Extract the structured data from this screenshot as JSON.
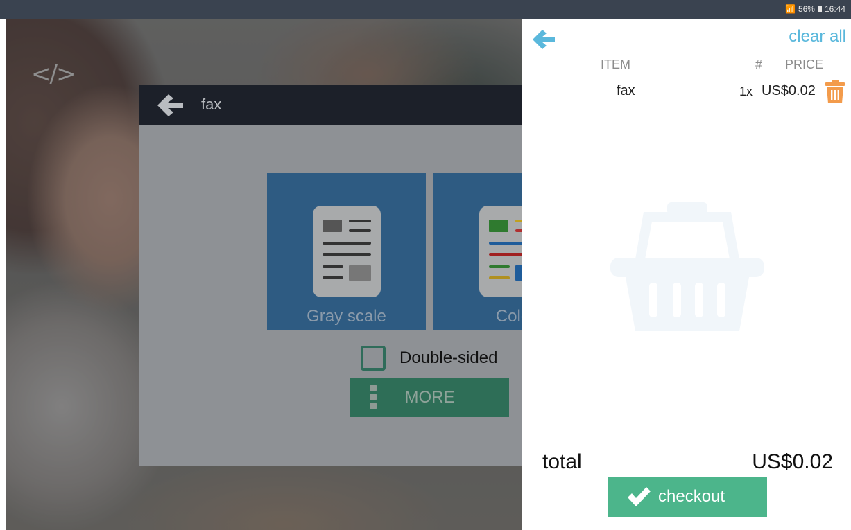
{
  "status_bar": {
    "battery": "56%",
    "time": "16:44",
    "icons": [
      "wifi-icon",
      "battery-icon"
    ]
  },
  "background": {
    "icon": "code-icon",
    "icon_text": "</>"
  },
  "dialog": {
    "title": "fax",
    "back_icon": "arrow-left-icon",
    "options": [
      {
        "label": "Gray scale",
        "icon": "grayscale-document-icon"
      },
      {
        "label": "Color",
        "visible_label": "Colo",
        "icon": "color-document-icon"
      }
    ],
    "double_sided_label": "Double-sided",
    "double_sided_checked": false,
    "more_label": "MORE",
    "more_icon": "more-vertical-icon"
  },
  "cart": {
    "back_icon": "arrow-left-icon",
    "clear_all_label": "clear all",
    "columns": {
      "item": "ITEM",
      "qty": "#",
      "price": "PRICE"
    },
    "items": [
      {
        "name": "fax",
        "qty": "1x",
        "price": "US$0.02",
        "delete_icon": "trash-icon"
      }
    ],
    "empty_icon": "basket-icon",
    "total_label": "total",
    "total_value": "US$0.02",
    "checkout_label": "checkout",
    "checkout_icon": "checkmark-icon"
  },
  "colors": {
    "accent_blue": "#5ab8dc",
    "checkout_green": "#4cb58b",
    "trash_orange": "#f39b4b",
    "tile_blue": "#2e5b82",
    "more_green": "#2e6e57",
    "dialog_header": "#1c2029"
  }
}
